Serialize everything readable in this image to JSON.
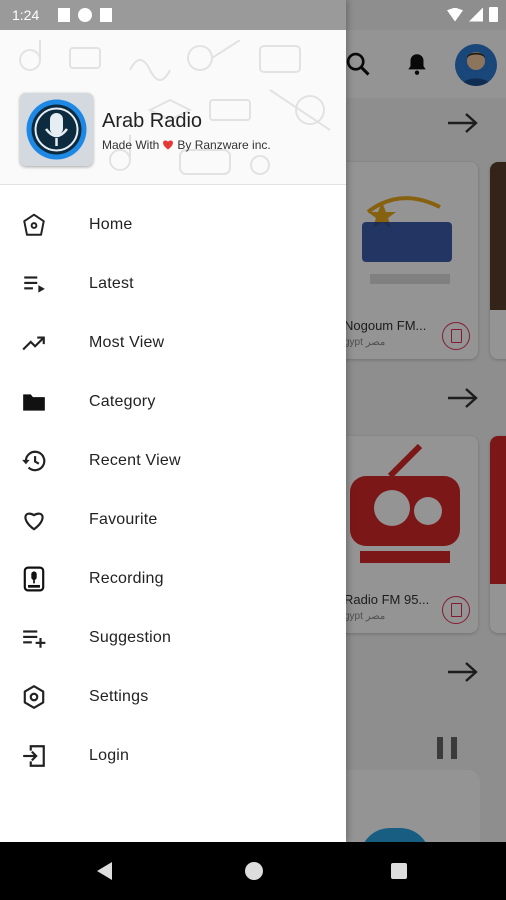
{
  "status_bar": {
    "time": "1:24"
  },
  "drawer": {
    "app_name": "Arab Radio",
    "tagline_prefix": "Made With",
    "tagline_suffix": "By Ranzware inc.",
    "menu": [
      {
        "label": "Home",
        "icon": "home-icon"
      },
      {
        "label": "Latest",
        "icon": "playlist-play-icon"
      },
      {
        "label": "Most View",
        "icon": "trending-up-icon"
      },
      {
        "label": "Category",
        "icon": "folder-icon"
      },
      {
        "label": "Recent View",
        "icon": "history-icon"
      },
      {
        "label": "Favourite",
        "icon": "heart-icon"
      },
      {
        "label": "Recording",
        "icon": "recorder-icon"
      },
      {
        "label": "Suggestion",
        "icon": "playlist-add-icon"
      },
      {
        "label": "Settings",
        "icon": "settings-icon"
      },
      {
        "label": "Login",
        "icon": "login-icon"
      }
    ]
  },
  "background": {
    "cards": [
      {
        "title": "Nogoum FM...",
        "subtitle": "gypt  مصر"
      },
      {
        "title": "Radio FM 95...",
        "subtitle": "gypt  مصر"
      }
    ]
  },
  "colors": {
    "accent": "#e03055",
    "logo_blue": "#1e88e5"
  }
}
